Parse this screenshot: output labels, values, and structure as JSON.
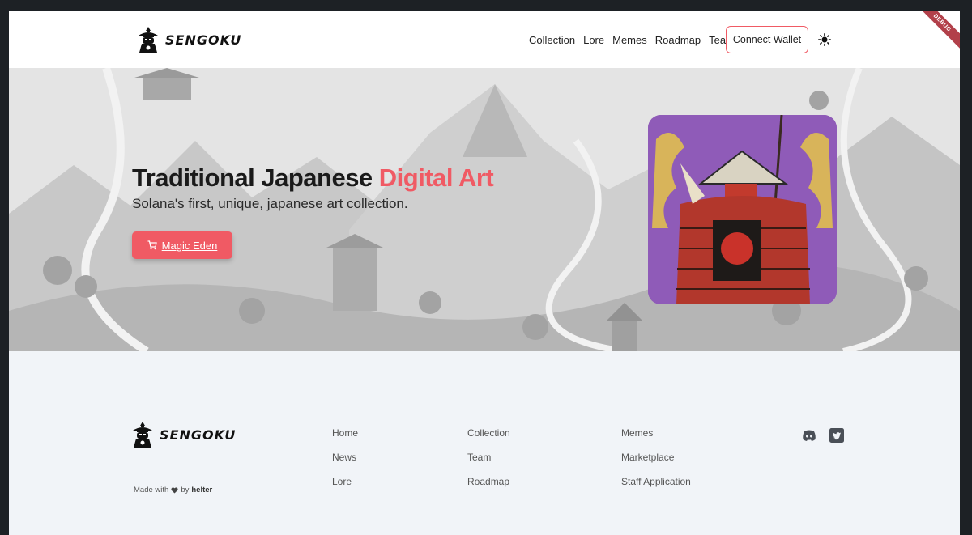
{
  "brand": {
    "name": "SENGOKU"
  },
  "nav": {
    "items": [
      "Collection",
      "Lore",
      "Memes",
      "Roadmap",
      "Team"
    ],
    "connect_wallet": "Connect Wallet"
  },
  "debug_ribbon": "DEBUG",
  "hero": {
    "title_main": "Traditional Japanese ",
    "title_accent": "Digital Art",
    "subtitle": "Solana's first, unique, japanese art collection.",
    "cta_label": "Magic Eden",
    "cta_icon": "cart-icon"
  },
  "footer": {
    "made_with_prefix": "Made with",
    "made_with_by": "by",
    "author": "helter",
    "col1": [
      "Home",
      "News",
      "Lore"
    ],
    "col2": [
      "Collection",
      "Team",
      "Roadmap"
    ],
    "col3": [
      "Memes",
      "Marketplace",
      "Staff Application"
    ],
    "social": [
      "discord-icon",
      "twitter-icon"
    ]
  },
  "colors": {
    "accent": "#f05a64",
    "dark": "#1d2125",
    "footer_bg": "#f1f4f8",
    "card_purple": "#8f5bb8"
  }
}
